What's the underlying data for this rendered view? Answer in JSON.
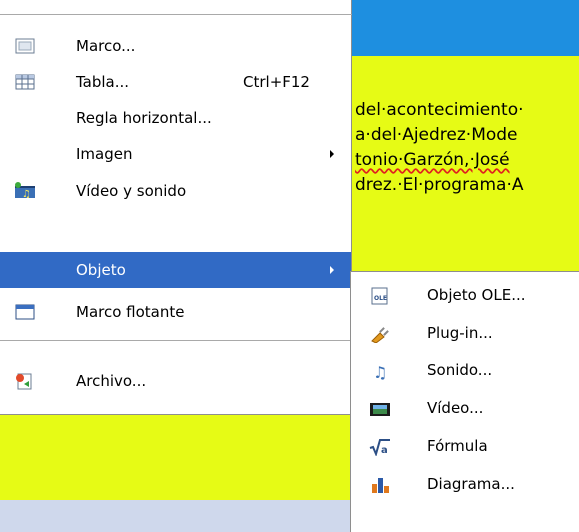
{
  "document": {
    "lines": [
      "del·acontecimiento·",
      "a·del·Ajedrez·Mode",
      "tonio·Garzón,·José",
      "drez.·El·programa·A"
    ]
  },
  "menu": {
    "items": [
      {
        "label": "Marco...",
        "icon": "frame-icon"
      },
      {
        "label": "Tabla...",
        "shortcut": "Ctrl+F12",
        "icon": "table-icon"
      },
      {
        "label": "Regla horizontal..."
      },
      {
        "label": "Imagen"
      },
      {
        "label": "Vídeo y sonido",
        "icon": "video-sound-icon"
      },
      {
        "label": "Objeto"
      },
      {
        "label": "Marco flotante",
        "icon": "floating-frame-icon"
      },
      {
        "label": "Archivo...",
        "icon": "insert-file-icon"
      }
    ]
  },
  "submenu": {
    "items": [
      {
        "label": "Objeto OLE...",
        "icon": "ole-object-icon"
      },
      {
        "label": "Plug-in...",
        "icon": "plugin-icon"
      },
      {
        "label": "Sonido...",
        "icon": "sound-icon"
      },
      {
        "label": "Vídeo...",
        "icon": "video-icon"
      },
      {
        "label": "Fórmula",
        "icon": "formula-icon"
      },
      {
        "label": "Diagrama...",
        "icon": "chart-icon"
      }
    ]
  },
  "colors": {
    "highlight": "#316ac5",
    "document_bg": "#e6fb15",
    "document_header": "#1e8fe0"
  }
}
